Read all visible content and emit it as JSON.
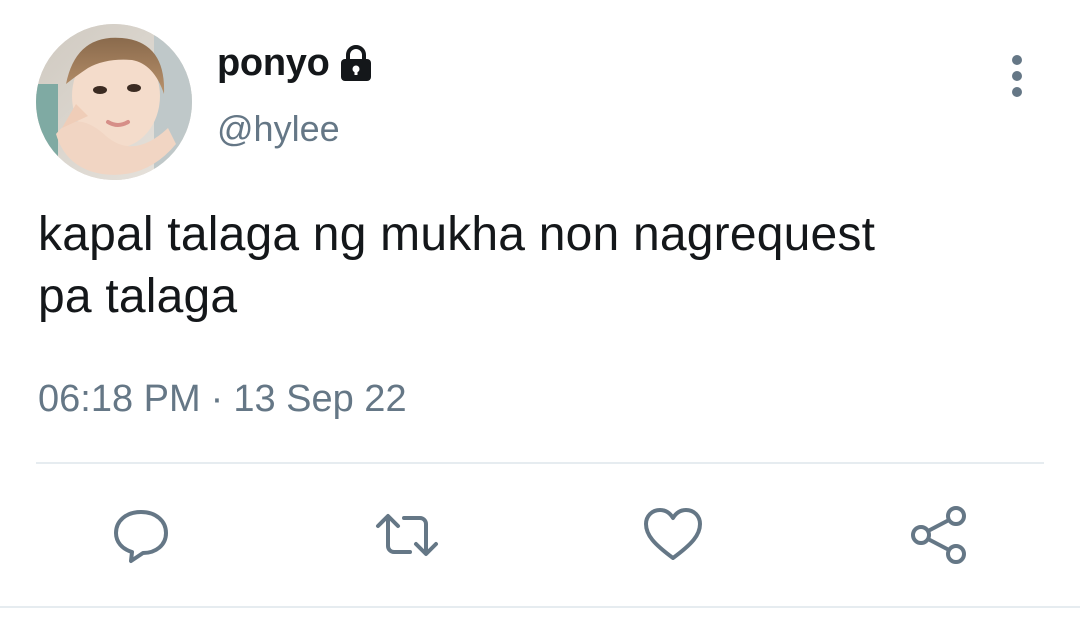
{
  "user": {
    "display_name": "ponyo",
    "handle": "@hylee",
    "protected_icon": "lock-icon",
    "avatar": "avatar-photo"
  },
  "tweet": {
    "text_line1": "kapal talaga ng mukha non nagrequest",
    "text_line2": "pa talaga",
    "time": "06:18 PM",
    "separator": "·",
    "date": "13 Sep 22"
  },
  "header": {
    "more_icon": "more-vertical-icon"
  },
  "actions": [
    {
      "icon": "reply-icon"
    },
    {
      "icon": "retweet-icon"
    },
    {
      "icon": "like-icon"
    },
    {
      "icon": "share-icon"
    }
  ],
  "colors": {
    "text_primary": "#14171a",
    "text_secondary": "#657786",
    "icon": "#657786",
    "divider": "#e6ecf0"
  }
}
